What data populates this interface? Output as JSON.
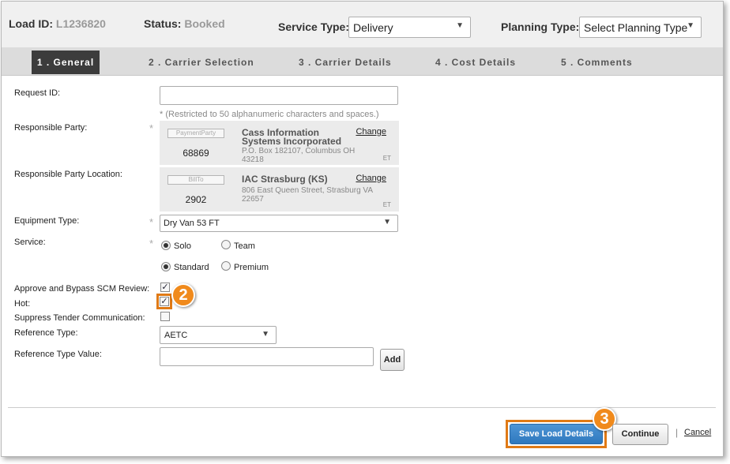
{
  "header": {
    "load_id_label": "Load ID:",
    "load_id_value": "L1236820",
    "status_label": "Status:",
    "status_value": "Booked",
    "service_type_label": "Service Type:",
    "service_type_value": "Delivery",
    "planning_type_label": "Planning Type:",
    "planning_type_value": "Select Planning Type"
  },
  "tabs": [
    {
      "label": "1 . General"
    },
    {
      "label": "2 . Carrier Selection"
    },
    {
      "label": "3 . Carrier Details"
    },
    {
      "label": "4 . Cost Details"
    },
    {
      "label": "5 . Comments"
    }
  ],
  "form": {
    "request_id_label": "Request ID:",
    "request_id_value": "",
    "request_id_hint": "* (Restricted to 50 alphanumeric characters and spaces.)",
    "responsible_party_label": "Responsible Party:",
    "responsible_party": {
      "role": "PaymentParty",
      "code": "68869",
      "name": "Cass Information Systems Incorporated",
      "address": "P.O. Box 182107, Columbus OH 43218",
      "change": "Change",
      "tz": "ET"
    },
    "responsible_location_label": "Responsible Party Location:",
    "responsible_location": {
      "role": "BillTo",
      "code": "2902",
      "name": "IAC Strasburg (KS)",
      "address": "806 East Queen Street, Strasburg VA 22657",
      "change": "Change",
      "tz": "ET"
    },
    "required_marker": "*",
    "equipment_type_label": "Equipment Type:",
    "equipment_type_value": "Dry Van 53 FT",
    "service_label": "Service:",
    "service_options": [
      "Solo",
      "Team"
    ],
    "service_selected": "Solo",
    "service_level_options": [
      "Standard",
      "Premium"
    ],
    "service_level_selected": "Standard",
    "approve_bypass_label": "Approve and Bypass SCM Review:",
    "approve_bypass_checked": true,
    "hot_label": "Hot:",
    "hot_checked": true,
    "suppress_tender_label": "Suppress Tender Communication:",
    "suppress_tender_checked": false,
    "reference_type_label": "Reference Type:",
    "reference_type_value": "AETC",
    "reference_value_label": "Reference Type Value:",
    "reference_value": "",
    "add_label": "Add",
    "check_mark": "✓",
    "dropdown_arrow": "▼"
  },
  "footer": {
    "save_label": "Save Load Details",
    "continue_label": "Continue",
    "separator": "|",
    "cancel_label": "Cancel"
  },
  "callouts": {
    "step2": "2",
    "step3": "3",
    "color": "#f08a1c"
  },
  "colors": {
    "save_button": "#3a85c9",
    "active_tab": "#3c3c3c",
    "highlight": "#e07a16"
  }
}
